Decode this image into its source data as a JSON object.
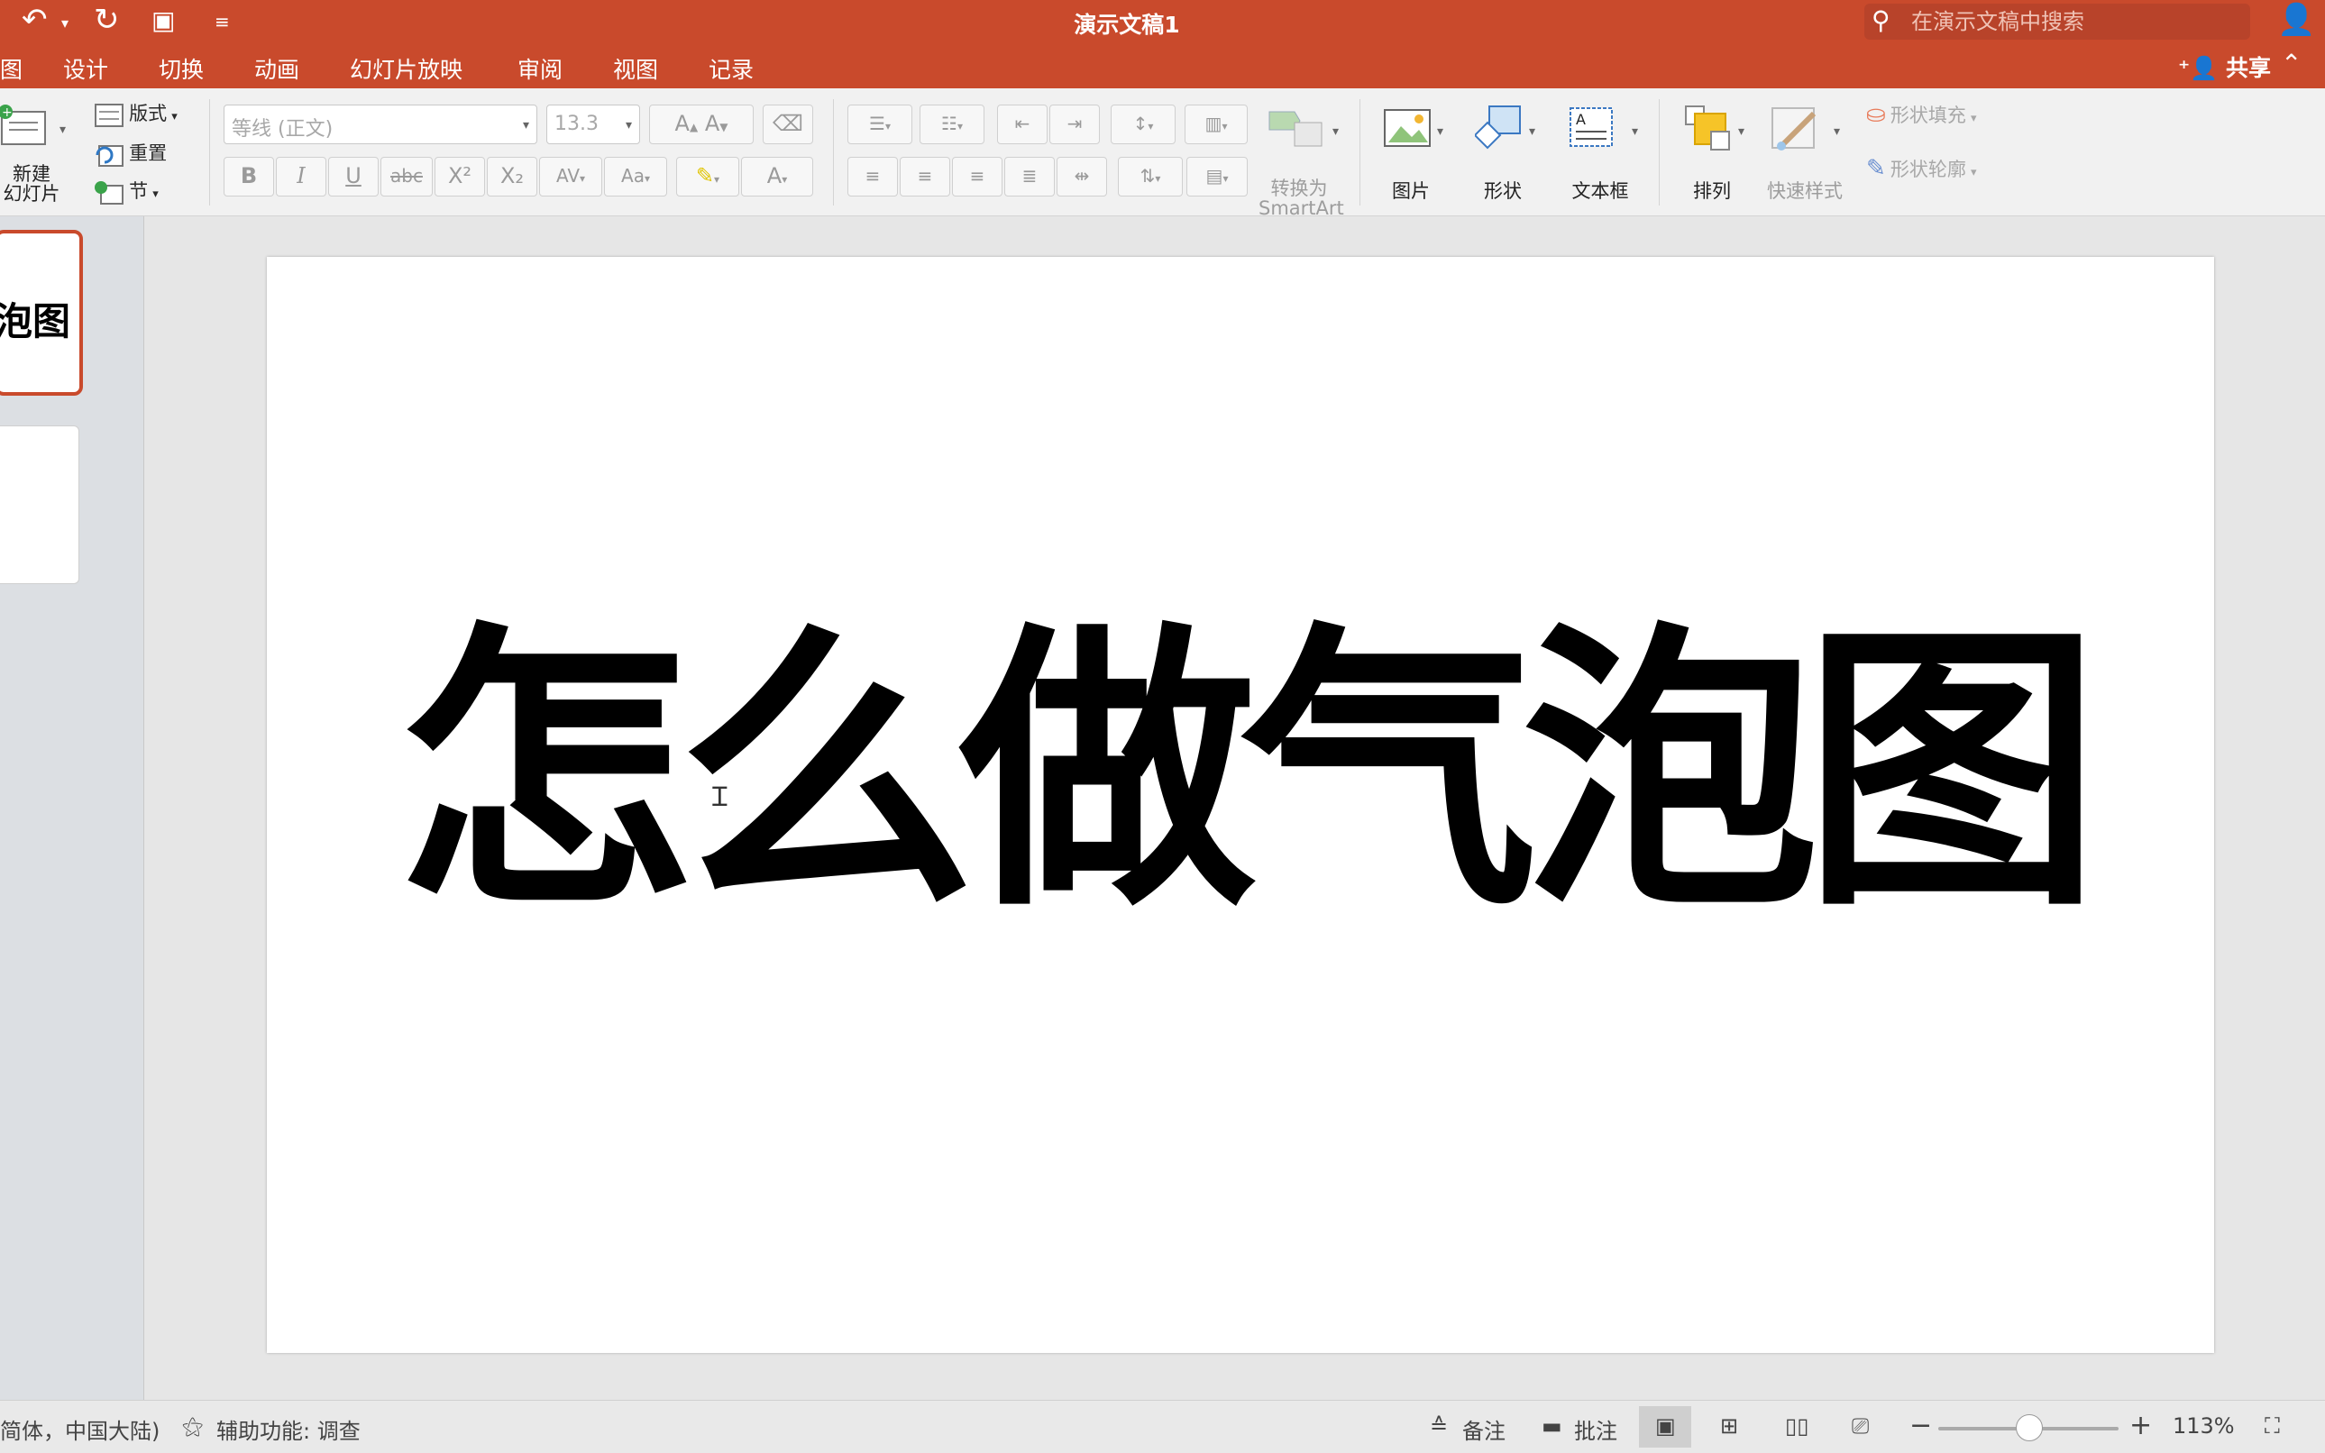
{
  "title_bar": {
    "document_title": "演示文稿1",
    "search_placeholder": "在演示文稿中搜索"
  },
  "tabs": [
    "图",
    "设计",
    "切换",
    "动画",
    "幻灯片放映",
    "审阅",
    "视图",
    "记录"
  ],
  "share_label": "共享",
  "ribbon": {
    "new_slide_label_line1": "新建",
    "new_slide_label_line2": "幻灯片",
    "layout_label": "版式",
    "reset_label": "重置",
    "section_label": "节",
    "font_name": "等线 (正文)",
    "font_size": "13.3",
    "bold": "B",
    "italic": "I",
    "underline": "U",
    "strike": "abc",
    "superscript": "X²",
    "subscript": "X₂",
    "spacing": "AV",
    "case": "Aa",
    "font_color": "A",
    "increase_font": "A",
    "decrease_font": "A",
    "smartart_line1": "转换为",
    "smartart_line2": "SmartArt",
    "picture_label": "图片",
    "shape_label": "形状",
    "textbox_label": "文本框",
    "arrange_label": "排列",
    "quick_styles_label": "快速样式",
    "shape_fill_label": "形状填充",
    "shape_outline_label": "形状轮廓"
  },
  "thumbnail": {
    "slide1_text": "泡图"
  },
  "slide": {
    "title": "怎么做气泡图"
  },
  "status_bar": {
    "language": "简体，中国大陆)",
    "accessibility": "辅助功能: 调查",
    "notes": "备注",
    "comments": "批注",
    "zoom": "113%"
  },
  "colors": {
    "accent": "#c94a2c"
  }
}
